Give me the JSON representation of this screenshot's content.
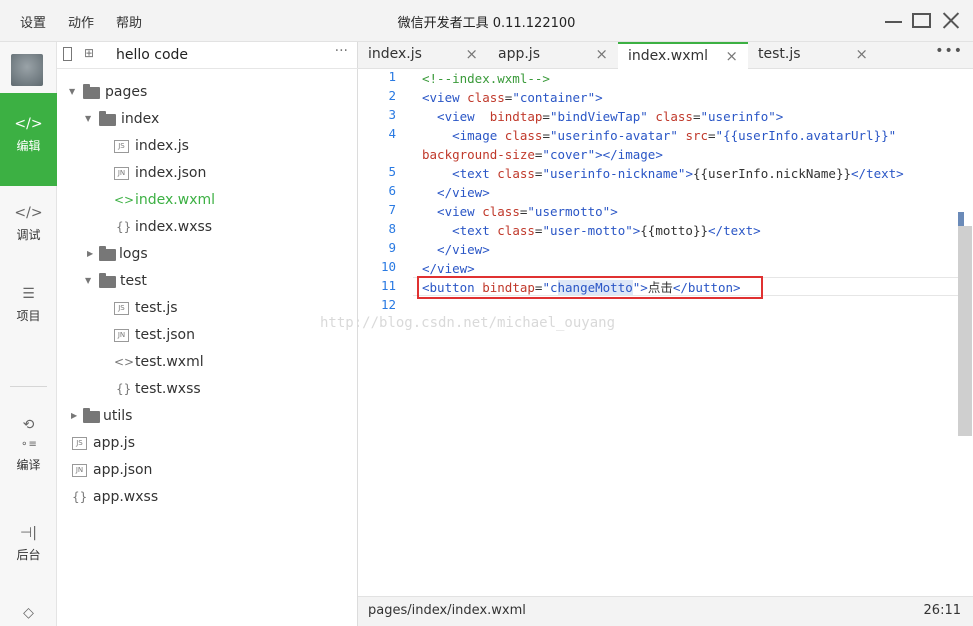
{
  "titlebar": {
    "menu": [
      "设置",
      "动作",
      "帮助"
    ],
    "title": "微信开发者工具 0.11.122100"
  },
  "activitybar": {
    "items": [
      {
        "label": "编辑",
        "icon": "code-icon",
        "active": true
      },
      {
        "label": "调试",
        "icon": "debug-icon",
        "active": false
      },
      {
        "label": "项目",
        "icon": "menu-icon",
        "active": false
      },
      {
        "label": "编译",
        "icon": "compile-icon",
        "active": false
      },
      {
        "label": "后台",
        "icon": "backend-icon",
        "active": false
      }
    ]
  },
  "tree": {
    "project": "hello code",
    "more": "···",
    "rows": [
      {
        "name": "pages",
        "type": "folder",
        "depth": 0,
        "expanded": true
      },
      {
        "name": "index",
        "type": "folder",
        "depth": 1,
        "expanded": true
      },
      {
        "name": "index.js",
        "type": "js",
        "depth": 2
      },
      {
        "name": "index.json",
        "type": "json",
        "depth": 2
      },
      {
        "name": "index.wxml",
        "type": "wxml",
        "depth": 2,
        "selected": true
      },
      {
        "name": "index.wxss",
        "type": "wxss",
        "depth": 2
      },
      {
        "name": "logs",
        "type": "folder",
        "depth": 1,
        "expanded": false
      },
      {
        "name": "test",
        "type": "folder",
        "depth": 1,
        "expanded": true
      },
      {
        "name": "test.js",
        "type": "js",
        "depth": 2
      },
      {
        "name": "test.json",
        "type": "json",
        "depth": 2
      },
      {
        "name": "test.wxml",
        "type": "wxml",
        "depth": 2
      },
      {
        "name": "test.wxss",
        "type": "wxss",
        "depth": 2
      },
      {
        "name": "utils",
        "type": "folder",
        "depth": 0,
        "expanded": false
      },
      {
        "name": "app.js",
        "type": "js",
        "depth": 0
      },
      {
        "name": "app.json",
        "type": "json",
        "depth": 0
      },
      {
        "name": "app.wxss",
        "type": "wxss",
        "depth": 0
      }
    ]
  },
  "tabs": [
    {
      "label": "index.js",
      "active": false
    },
    {
      "label": "app.js",
      "active": false
    },
    {
      "label": "index.wxml",
      "active": true
    },
    {
      "label": "test.js",
      "active": false
    }
  ],
  "tabs_more": "•••",
  "editor": {
    "lines": [
      {
        "n": "1",
        "parts": [
          [
            "c-comment",
            "<!--index.wxml-->"
          ]
        ]
      },
      {
        "n": "2",
        "parts": [
          [
            "c-tag",
            "<view "
          ],
          [
            "c-attr",
            "class"
          ],
          [
            "c-txt",
            "="
          ],
          [
            "c-str",
            "\"container\""
          ],
          [
            "c-tag",
            ">"
          ]
        ]
      },
      {
        "n": "3",
        "parts": [
          [
            "c-tag",
            "  <view  "
          ],
          [
            "c-attr",
            "bindtap"
          ],
          [
            "c-txt",
            "="
          ],
          [
            "c-str",
            "\"bindViewTap\""
          ],
          [
            "c-txt",
            " "
          ],
          [
            "c-attr",
            "class"
          ],
          [
            "c-txt",
            "="
          ],
          [
            "c-str",
            "\"userinfo\""
          ],
          [
            "c-tag",
            ">"
          ]
        ]
      },
      {
        "n": "4",
        "parts": [
          [
            "c-tag",
            "    <image "
          ],
          [
            "c-attr",
            "class"
          ],
          [
            "c-txt",
            "="
          ],
          [
            "c-str",
            "\"userinfo-avatar\""
          ],
          [
            "c-txt",
            " "
          ],
          [
            "c-attr",
            "src"
          ],
          [
            "c-txt",
            "="
          ],
          [
            "c-str",
            "\"{{userInfo.avatarUrl}}\""
          ]
        ]
      },
      {
        "n": "",
        "parts": [
          [
            "c-attr",
            "background-size"
          ],
          [
            "c-txt",
            "="
          ],
          [
            "c-str",
            "\"cover\""
          ],
          [
            "c-tag",
            "></image>"
          ]
        ]
      },
      {
        "n": "5",
        "parts": [
          [
            "c-tag",
            "    <text "
          ],
          [
            "c-attr",
            "class"
          ],
          [
            "c-txt",
            "="
          ],
          [
            "c-str",
            "\"userinfo-nickname\""
          ],
          [
            "c-tag",
            ">"
          ],
          [
            "c-txt",
            "{{userInfo.nickName}}"
          ],
          [
            "c-tag",
            "</text>"
          ]
        ]
      },
      {
        "n": "6",
        "parts": [
          [
            "c-tag",
            "  </view>"
          ]
        ]
      },
      {
        "n": "7",
        "parts": [
          [
            "c-tag",
            "  <view "
          ],
          [
            "c-attr",
            "class"
          ],
          [
            "c-txt",
            "="
          ],
          [
            "c-str",
            "\"usermotto\""
          ],
          [
            "c-tag",
            ">"
          ]
        ]
      },
      {
        "n": "8",
        "parts": [
          [
            "c-tag",
            "    <text "
          ],
          [
            "c-attr",
            "class"
          ],
          [
            "c-txt",
            "="
          ],
          [
            "c-str",
            "\"user-motto\""
          ],
          [
            "c-tag",
            ">"
          ],
          [
            "c-txt",
            "{{motto}}"
          ],
          [
            "c-tag",
            "</text>"
          ]
        ]
      },
      {
        "n": "9",
        "parts": [
          [
            "c-tag",
            "  </view>"
          ]
        ]
      },
      {
        "n": "10",
        "parts": [
          [
            "c-tag",
            "</view>"
          ]
        ]
      },
      {
        "n": "11",
        "parts": [
          [
            "c-tag",
            "<button "
          ],
          [
            "c-attr",
            "bindtap"
          ],
          [
            "c-txt",
            "="
          ],
          [
            "c-str",
            "\"c"
          ],
          [
            "c-str c-hl",
            "hangeMotto"
          ],
          [
            "c-str",
            "\""
          ],
          [
            "c-tag",
            ">"
          ],
          [
            "c-txt",
            "点击"
          ],
          [
            "c-tag",
            "</button>"
          ]
        ]
      },
      {
        "n": "12",
        "parts": []
      }
    ],
    "watermark": "http://blog.csdn.net/michael_ouyang"
  },
  "statusbar": {
    "path": "pages/index/index.wxml",
    "position": "26:11"
  }
}
